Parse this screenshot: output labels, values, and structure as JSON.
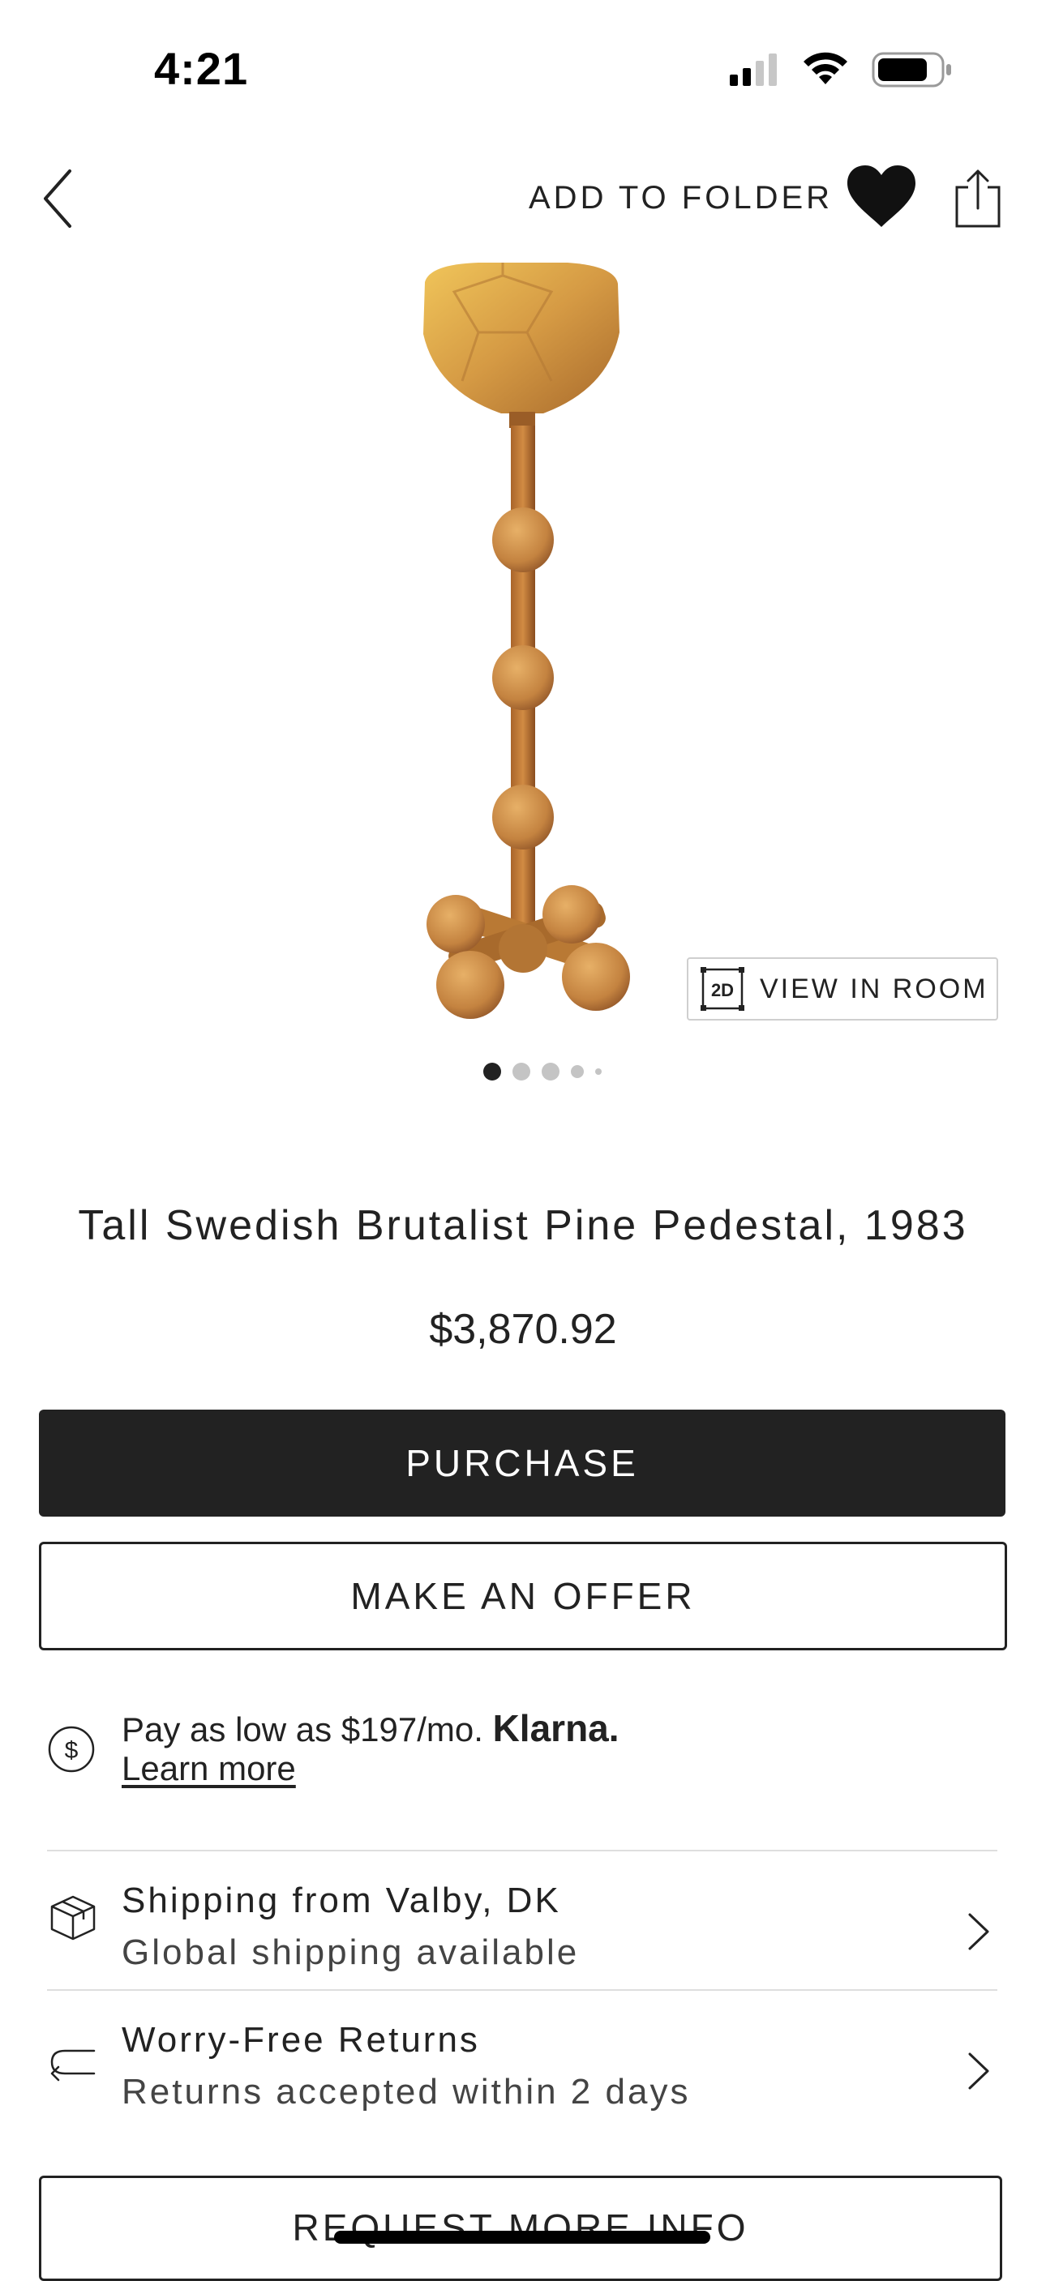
{
  "status_bar": {
    "time": "4:21",
    "icons": [
      "cellular-signal-icon",
      "wifi-icon",
      "battery-icon"
    ]
  },
  "header": {
    "back_icon": "chevron-left-icon",
    "add_to_folder": "ADD TO FOLDER",
    "favorite_icon": "heart-icon",
    "share_icon": "share-icon"
  },
  "gallery": {
    "view_in_room_icon": "2D",
    "view_in_room_label": "VIEW IN ROOM",
    "dot_count": 5,
    "active_dot": 1
  },
  "product": {
    "title": "Tall Swedish Brutalist Pine Pedestal, 1983",
    "price": "$3,870.92"
  },
  "actions": {
    "purchase": "PURCHASE",
    "make_offer": "MAKE AN OFFER",
    "request_info": "REQUEST MORE INFO"
  },
  "financing": {
    "icon": "dollar-circle-icon",
    "text": "Pay as low as $197/mo.",
    "brand": "Klarna.",
    "link": "Learn more"
  },
  "shipping": {
    "icon": "box-icon",
    "title": "Shipping from Valby, DK",
    "subtitle": "Global shipping available"
  },
  "returns": {
    "icon": "return-arrow-icon",
    "title": "Worry-Free Returns",
    "subtitle": "Returns accepted within 2 days"
  },
  "colors": {
    "primary": "#222222",
    "background": "#ffffff",
    "divider": "#dedede",
    "wood": "#c8893f"
  }
}
